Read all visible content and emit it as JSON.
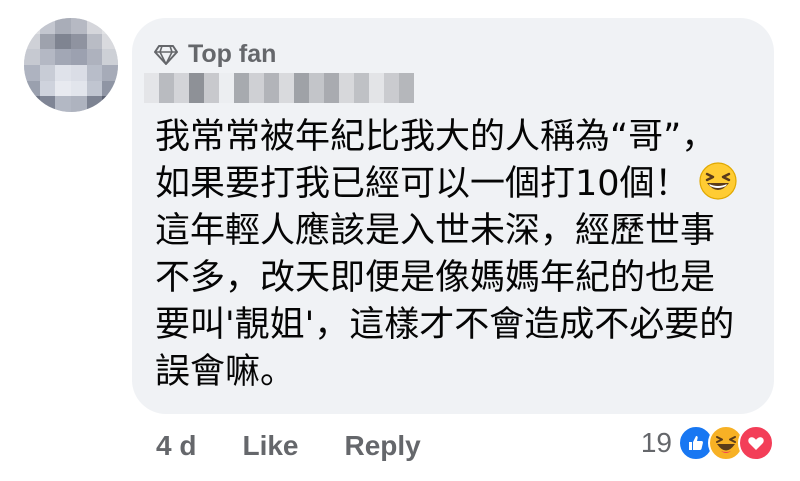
{
  "comment": {
    "badge_icon": "diamond-icon",
    "badge_label": "Top fan",
    "text_lines": [
      "我常常被年紀比我大的人稱為“哥”，",
      "如果要打我已經可以一個打10個！",
      "這年輕人應該是入世未深，經歷世事",
      "不多，改天即便是像媽媽年紀的也是",
      "要叫'靚姐'，這樣才不會造成不必要的",
      "誤會嘛。"
    ],
    "emoji": "grinning-squinting-face-icon"
  },
  "actions": {
    "time": "4 d",
    "like_label": "Like",
    "reply_label": "Reply"
  },
  "reactions": {
    "count": "19",
    "icons": [
      "like-reaction-icon",
      "haha-reaction-icon",
      "love-reaction-icon"
    ]
  },
  "colors": {
    "bubble_bg": "#f0f2f5",
    "secondary_text": "#65676b",
    "primary_text": "#050505",
    "like_blue": "#1877f2",
    "love_red": "#f33e58",
    "haha_yellow": "#f7b125"
  }
}
